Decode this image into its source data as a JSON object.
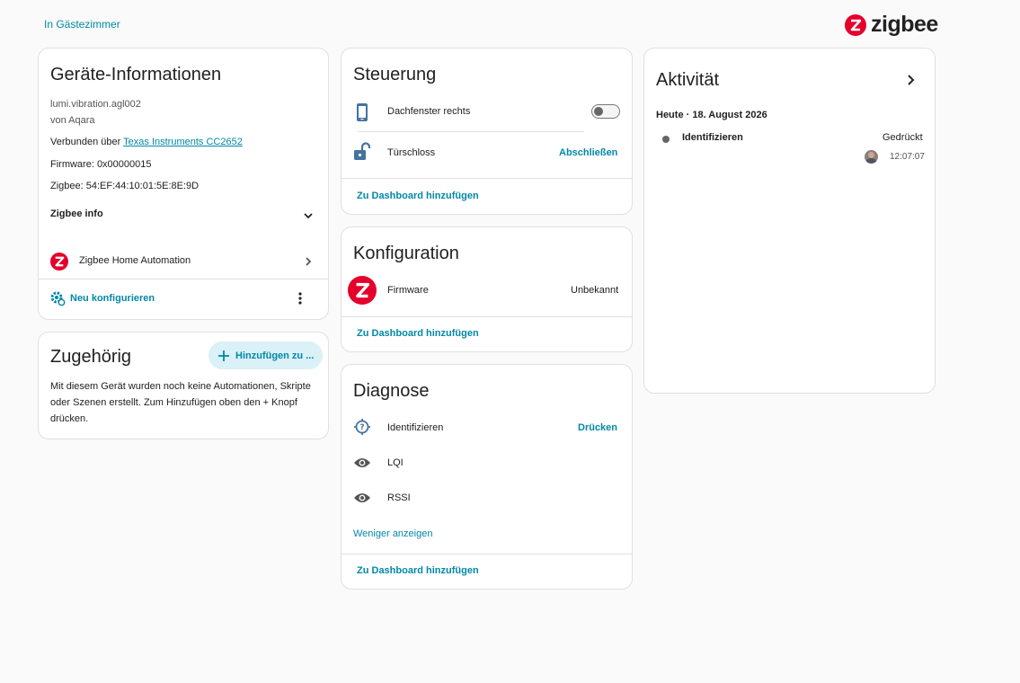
{
  "breadcrumb": {
    "area": "In Gästezimmer"
  },
  "brand": {
    "name": "zigbee",
    "color": "#e4002b"
  },
  "device_info": {
    "title": "Geräte-Informationen",
    "model": "lumi.vibration.agl002",
    "manufacturer": "von Aqara",
    "connected_prefix": "Verbunden über ",
    "connected_link": "Texas Instruments CC2652",
    "firmware": "Firmware: 0x00000015",
    "zigbee_id": "Zigbee: 54:EF:44:10:01:5E:8E:9D",
    "zigbee_info_label": "Zigbee info",
    "integration_label": "Zigbee Home Automation",
    "reconfigure_label": "Neu konfigurieren"
  },
  "related": {
    "title": "Zugehörig",
    "add_label": "Hinzufügen zu ...",
    "description": "Mit diesem Gerät wurden noch keine Automationen, Skripte oder Szenen erstellt. Zum Hinzufügen oben den + Knopf drücken."
  },
  "controls": {
    "title": "Steuerung",
    "items": [
      {
        "icon": "phone-icon",
        "label": "Dachfenster rechts",
        "type": "toggle",
        "state": "off"
      },
      {
        "icon": "lock-open-icon",
        "label": "Türschloss",
        "action": "Abschließen"
      }
    ],
    "add_dashboard": "Zu Dashboard hinzufügen"
  },
  "configuration": {
    "title": "Konfiguration",
    "items": [
      {
        "icon": "zigbee-icon",
        "label": "Firmware",
        "value": "Unbekannt"
      }
    ],
    "add_dashboard": "Zu Dashboard hinzufügen"
  },
  "diagnostics": {
    "title": "Diagnose",
    "items": [
      {
        "icon": "identify-icon",
        "label": "Identifizieren",
        "action": "Drücken"
      },
      {
        "icon": "eye-icon",
        "label": "LQI"
      },
      {
        "icon": "eye-icon",
        "label": "RSSI"
      }
    ],
    "show_less": "Weniger anzeigen",
    "add_dashboard": "Zu Dashboard hinzufügen"
  },
  "activity": {
    "title": "Aktivität",
    "date_header": "Heute · 18. August 2026",
    "entries": [
      {
        "name": "Identifizieren",
        "state": "Gedrückt",
        "time": "12:07:07"
      }
    ]
  },
  "colors": {
    "accent": "#0288a7",
    "zigbee_red": "#e4002b",
    "icon_blue": "#44739e"
  }
}
